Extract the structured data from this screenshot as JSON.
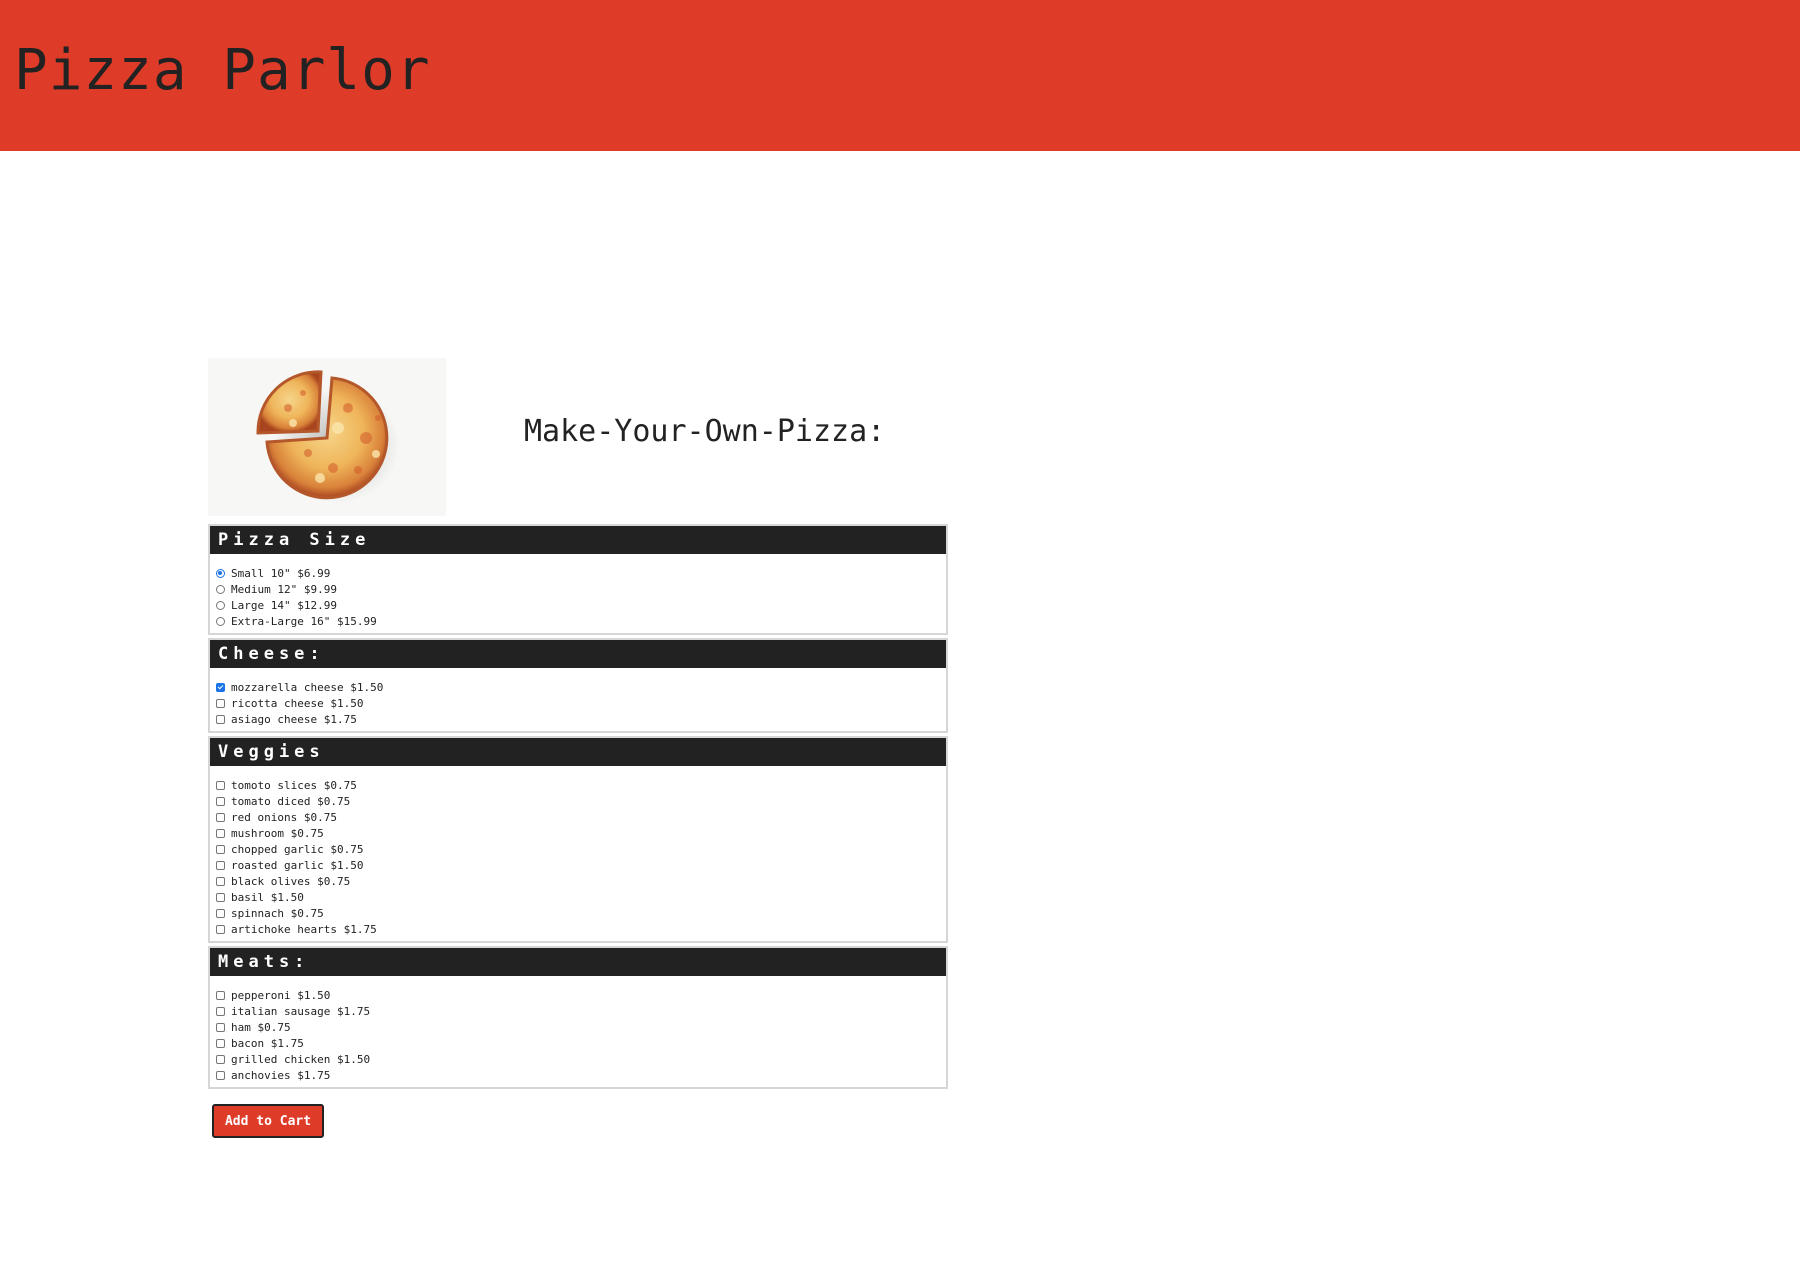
{
  "header": {
    "title": "Pizza Parlor",
    "bg_color": "#de3c28"
  },
  "main": {
    "image_alt": "pizza with a missing slice",
    "builder_title": "Make-Your-Own-Pizza:"
  },
  "sections": {
    "size": {
      "title": "Pizza Size",
      "options": [
        {
          "label": "Small 10\" $6.99",
          "selected": true
        },
        {
          "label": "Medium 12\" $9.99",
          "selected": false
        },
        {
          "label": "Large 14\" $12.99",
          "selected": false
        },
        {
          "label": "Extra-Large 16\" $15.99",
          "selected": false
        }
      ]
    },
    "cheese": {
      "title": "Cheese:",
      "options": [
        {
          "label": "mozzarella cheese $1.50",
          "checked": true
        },
        {
          "label": "ricotta cheese $1.50",
          "checked": false
        },
        {
          "label": "asiago cheese $1.75",
          "checked": false
        }
      ]
    },
    "veggies": {
      "title": "Veggies",
      "options": [
        {
          "label": "tomoto slices $0.75",
          "checked": false
        },
        {
          "label": "tomato diced $0.75",
          "checked": false
        },
        {
          "label": "red onions $0.75",
          "checked": false
        },
        {
          "label": "mushroom $0.75",
          "checked": false
        },
        {
          "label": "chopped garlic $0.75",
          "checked": false
        },
        {
          "label": "roasted garlic $1.50",
          "checked": false
        },
        {
          "label": "black olives $0.75",
          "checked": false
        },
        {
          "label": "basil $1.50",
          "checked": false
        },
        {
          "label": "spinnach $0.75",
          "checked": false
        },
        {
          "label": "artichoke hearts $1.75",
          "checked": false
        }
      ]
    },
    "meats": {
      "title": "Meats:",
      "options": [
        {
          "label": "pepperoni $1.50",
          "checked": false
        },
        {
          "label": "italian sausage $1.75",
          "checked": false
        },
        {
          "label": "ham $0.75",
          "checked": false
        },
        {
          "label": "bacon $1.75",
          "checked": false
        },
        {
          "label": "grilled chicken $1.50",
          "checked": false
        },
        {
          "label": "anchovies $1.75",
          "checked": false
        }
      ]
    }
  },
  "cart": {
    "add_label": "Add to Cart"
  },
  "colors": {
    "accent": "#de3c28",
    "section_header": "#222222",
    "control_checked": "#1a73e8"
  }
}
